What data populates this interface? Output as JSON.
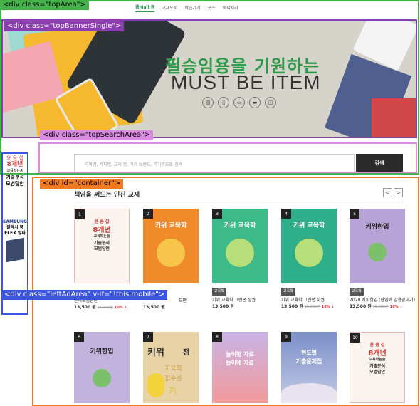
{
  "overlay_labels": {
    "top_area": "<div class=\"topArea\">",
    "top_banner": "<div class=\"topBannerSingle\">",
    "top_search": "<div class=\"topSearchArea\">",
    "container": "<div id=\"container\">",
    "left_ad": "<div class=\"leftAdArea\" v-if=\"!this.mobile\">"
  },
  "nav": [
    "웹Mall 홈",
    "교재도서",
    "학습기기",
    "굿즈",
    "액세서리"
  ],
  "banner": {
    "title": "필승임용을 기원하는",
    "subtitle": "MUST BE ITEM",
    "icons": [
      "book-icon",
      "phone-icon",
      "tablet-icon",
      "laptop-icon",
      "ebook-icon"
    ]
  },
  "search": {
    "placeholder": "과목명, 저자명, 교재 명, 기기 브랜드, 기기명으로 검색",
    "button": "검색"
  },
  "left_ad": {
    "ad1_lines": [
      "윤 용 섭",
      "8개년",
      "교육학논술",
      "기출분석",
      "모범답안"
    ],
    "ad2_lines": [
      "SAMSUNG",
      "갤럭시 북",
      "FLEX 알파"
    ]
  },
  "section": {
    "title": "책임을 써드는 인진 교재",
    "prev": "<",
    "next": ">"
  },
  "books": [
    {
      "rank": "1",
      "cover_lines": [
        "윤 용 섭",
        "8개년",
        "교육학논술",
        "기출분석",
        "모범답안"
      ],
      "cat": "",
      "name": "분석모범답안",
      "price": "13,500 원",
      "orig": "15,000원",
      "pct": "10% ↓"
    },
    {
      "rank": "2",
      "cover_lines": [
        "키위 교육학"
      ],
      "cat": "",
      "name": "드편",
      "price": "13,500 원",
      "orig": "",
      "pct": ""
    },
    {
      "rank": "3",
      "cover_lines": [
        "키위 교육학"
      ],
      "cat": "교육학",
      "name": "키위 교육학 그린편 상권",
      "price": "13,500 원",
      "orig": "",
      "pct": ""
    },
    {
      "rank": "4",
      "cover_lines": [
        "키위 교육학"
      ],
      "cat": "교육학",
      "name": "키위 교육학 그린편 하권",
      "price": "13,500 원",
      "orig": "15,000원",
      "pct": "10% ↓"
    },
    {
      "rank": "5",
      "cover_lines": [
        "키위한입"
      ],
      "cat": "교육학",
      "name": "2020 키위한입 (한입에 임용끝내기)",
      "price": "13,500 원",
      "orig": "15,000원",
      "pct": "10% ↓"
    },
    {
      "rank": "6",
      "cover_lines": [
        "키위한입"
      ],
      "cat": "",
      "name": "",
      "price": "",
      "orig": "",
      "pct": ""
    },
    {
      "rank": "7",
      "cover_lines": [
        "키위",
        "잼",
        "교육학",
        "점수를",
        "키"
      ],
      "cat": "",
      "name": "",
      "price": "",
      "orig": "",
      "pct": ""
    },
    {
      "rank": "8",
      "cover_lines": [
        "놀이형 자료",
        "놀이에 자료"
      ],
      "cat": "",
      "name": "",
      "price": "",
      "orig": "",
      "pct": ""
    },
    {
      "rank": "9",
      "cover_lines": [
        "현도별",
        "기출문제집"
      ],
      "cat": "",
      "name": "",
      "price": "",
      "orig": "",
      "pct": ""
    },
    {
      "rank": "10",
      "cover_lines": [
        "윤 용 섭",
        "8개년",
        "교육학논술",
        "기출분석",
        "모범답안"
      ],
      "cat": "",
      "name": "",
      "price": "",
      "orig": "",
      "pct": ""
    }
  ],
  "colors": {
    "top_area": "#44b34a",
    "banner_box": "#8a3fb0",
    "search_box": "#d98be0",
    "container": "#f07a20",
    "left_ad": "#3a55e0"
  }
}
